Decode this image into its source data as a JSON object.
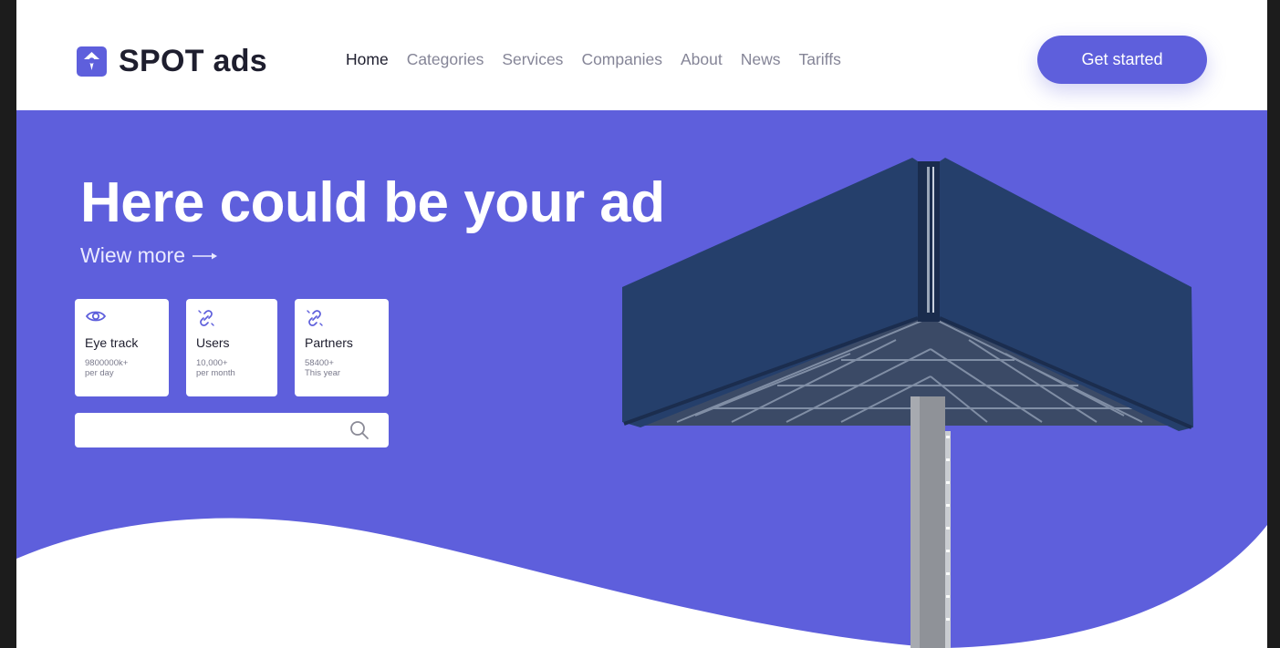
{
  "brand": {
    "name": "SPOT ads",
    "accent": "#5e5fdc",
    "dark": "#1e1e2e"
  },
  "nav": {
    "items": [
      {
        "label": "Home",
        "active": true
      },
      {
        "label": "Categories",
        "active": false
      },
      {
        "label": "Services",
        "active": false
      },
      {
        "label": "Companies",
        "active": false
      },
      {
        "label": "About",
        "active": false
      },
      {
        "label": "News",
        "active": false
      },
      {
        "label": "Tariffs",
        "active": false
      }
    ]
  },
  "header": {
    "cta_label": "Get started"
  },
  "hero": {
    "title": "Here could be your ad",
    "view_more": "Wiew more",
    "view_more_icon": "arrow-right-icon",
    "background": "#5e5fdc"
  },
  "stats": [
    {
      "icon": "eye-icon",
      "label": "Eye track",
      "value": "9800000k+",
      "period": "per day"
    },
    {
      "icon": "link-icon",
      "label": "Users",
      "value": "10,000+",
      "period": "per month"
    },
    {
      "icon": "link-icon",
      "label": "Partners",
      "value": "58400+",
      "period": "This year"
    }
  ],
  "search": {
    "placeholder": "",
    "icon": "search-icon"
  },
  "illustration": {
    "icon": "billboard-illustration"
  }
}
